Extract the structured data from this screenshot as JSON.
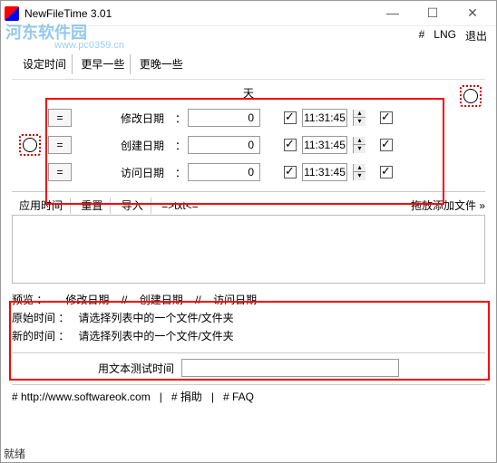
{
  "window": {
    "title": "NewFileTime 3.01",
    "min": "—",
    "max": "☐",
    "close": "✕"
  },
  "watermark": {
    "text1": "河东软件园",
    "text2": "www.pc0359.cn"
  },
  "menu": {
    "hash": "#",
    "lng": "LNG",
    "exit": "退出"
  },
  "tabs": {
    "set": "设定时间",
    "earlier": "更早一些",
    "later": "更晚一些"
  },
  "daylabel": "天",
  "rows": [
    {
      "label": "修改日期",
      "value": "0",
      "time": "11:31:45"
    },
    {
      "label": "创建日期",
      "value": "0",
      "time": "11:31:45"
    },
    {
      "label": "访问日期",
      "value": "0",
      "time": "11:31:45"
    }
  ],
  "eq": "=",
  "toolbar2": {
    "apply": "应用时间",
    "reset": "重置",
    "import": "导入",
    "txt": "=>txt<=",
    "drag": "拖放添加文件 »"
  },
  "preview": {
    "title": "预览 ：",
    "mod": "修改日期",
    "sep": "//",
    "cre": "创建日期",
    "acc": "访问日期",
    "orig_lab": "原始时间 ：",
    "new_lab": "新的时间 ：",
    "msg": "请选择列表中的一个文件/文件夹"
  },
  "test": {
    "label": "用文本测试时间",
    "value": ""
  },
  "footer": {
    "url": "# http://www.softwareok.com",
    "donate": "# 捐助",
    "faq": "# FAQ"
  },
  "status": "就绪"
}
